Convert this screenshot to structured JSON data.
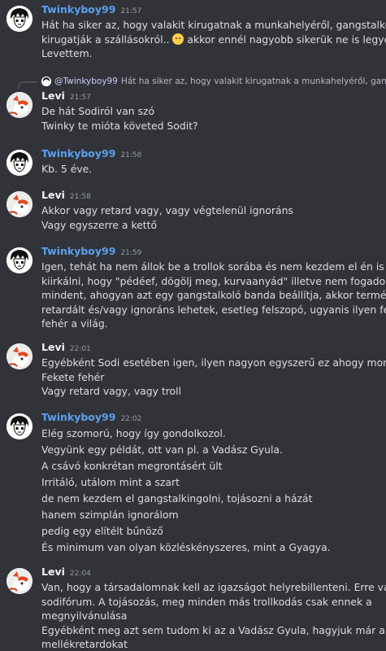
{
  "messages": [
    {
      "author": "Twinkyboy99",
      "time": "21:57",
      "avatar": "twinky",
      "lines": [
        "Hát ha siker az, hogy valakit kirugatnak a munkahelyéről, gangstalkolnak,",
        "kirugatják a szállásokról.. [emoji] akkor ennél nagyobb sikerük ne is legyen.",
        "Levettem."
      ]
    },
    {
      "reply_to": "@Twinkyboy99",
      "reply_text": "Hát ha siker az, hogy valakit kirugatnak a munkahelyéről, gangstalkol...",
      "author": "Levi",
      "time": "21:57",
      "avatar": "levi",
      "lines": [
        "De hát Sodiról van szó",
        "Twinky te mióta követed Sodit?"
      ]
    },
    {
      "author": "Twinkyboy99",
      "time": "21:58",
      "avatar": "twinky",
      "lines": [
        "Kb. 5 éve."
      ]
    },
    {
      "author": "Levi",
      "time": "21:58",
      "avatar": "levi",
      "lines": [
        "Akkor vagy retard vagy, vagy végtelenül ignoráns",
        "Vagy egyszerre a kettő"
      ]
    },
    {
      "author": "Twinkyboy99",
      "time": "21:59",
      "avatar": "twinky",
      "lines": [
        "Igen, tehát ha nem állok be a trollok sorába és nem kezdem el én is a fórumra",
        "kiirkálni, hogy \"pédéef, dögölj meg, kurvaanyád\" illetve nem fogadok el",
        "mindent, ahogyan azt egy gangstalkoló banda beállítja, akkor természetesen",
        "retardált és/vagy ignoráns lehetek, esetleg felszopó, ugyanis ilyen fekete-",
        "fehér a világ."
      ]
    },
    {
      "author": "Levi",
      "time": "22:01",
      "avatar": "levi",
      "lines": [
        "Egyébként Sodi esetében igen, ilyen nagyon egyszerű ez ahogy mondod.",
        "Fekete fehér",
        "Vagy retard vagy, vagy troll"
      ]
    },
    {
      "author": "Twinkyboy99",
      "time": "22:02",
      "avatar": "twinky",
      "lines": [
        "Elég szomorú, hogy így gondolkozol.",
        "Vegyünk egy példát, ott van pl. a Vadász Gyula.",
        "A csávó konkrétan megrontásért ült",
        "Irritáló, utálom mint a szart",
        "de nem kezdem el gangstalkingolni, tojásozni a házát",
        "hanem szimplán ignorálom",
        "pedig egy elítélt bűnöző",
        "És minimum van olyan közléskényszeres, mint a Gyagya."
      ]
    },
    {
      "author": "Levi",
      "time": "22:04",
      "avatar": "levi",
      "lines": [
        "Van, hogy a társadalomnak kell az igazságot helyrebillenteni. Erre van a",
        "sodifórum. A tojásozás, meg minden más trollkodás csak ennek a",
        "megnyilvánulása",
        "Egyébként meg azt sem tudom ki az a Vadász Gyula, hagyjuk már a",
        "mellékretardokat"
      ]
    }
  ]
}
